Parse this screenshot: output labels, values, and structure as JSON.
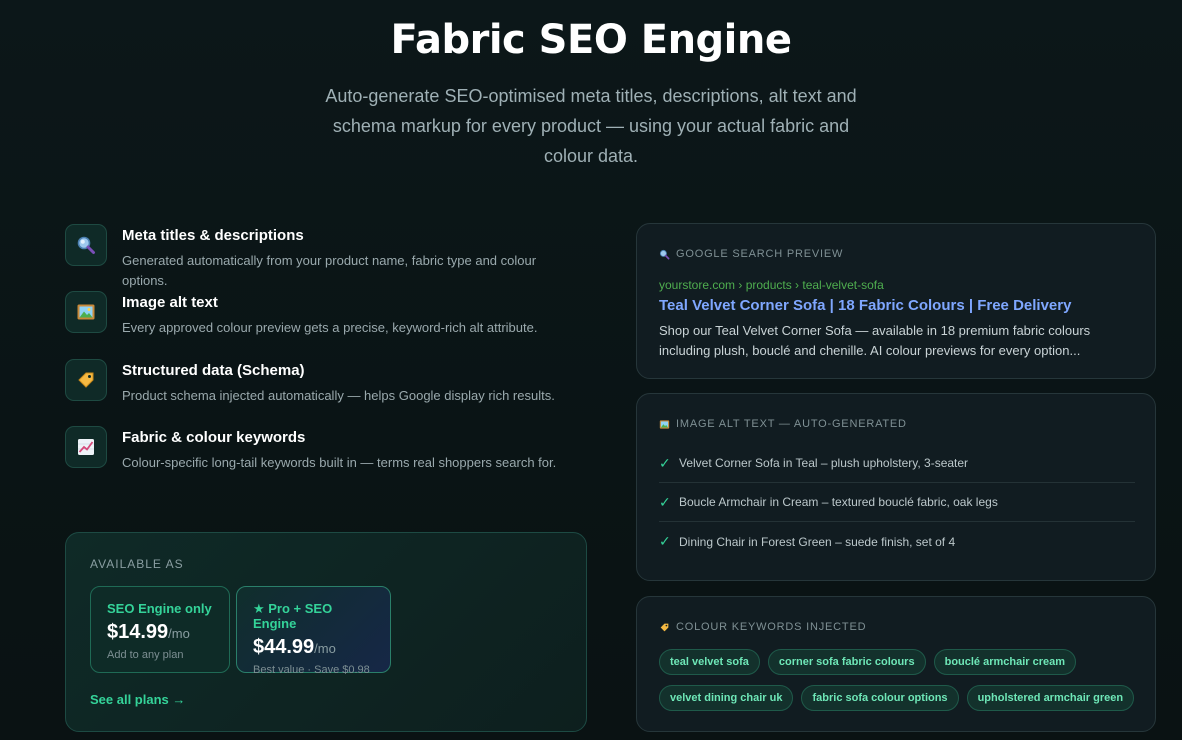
{
  "hero": {
    "title": "Fabric SEO Engine",
    "subtitle": "Auto-generate SEO-optimised meta titles, descriptions, alt text and schema markup for every product — using your actual fabric and colour data."
  },
  "features": [
    {
      "icon": "magnifier-icon",
      "title": "Meta titles & descriptions",
      "desc": "Generated automatically from your product name, fabric type and colour options."
    },
    {
      "icon": "picture-icon",
      "title": "Image alt text",
      "desc": "Every approved colour preview gets a precise, keyword-rich alt attribute."
    },
    {
      "icon": "tag-icon",
      "title": "Structured data (Schema)",
      "desc": "Product schema injected automatically — helps Google display rich results."
    },
    {
      "icon": "chart-icon",
      "title": "Fabric & colour keywords",
      "desc": "Colour-specific long-tail keywords built in — terms real shoppers search for."
    }
  ],
  "available": {
    "label": "AVAILABLE AS",
    "plans": [
      {
        "name": "SEO Engine only",
        "price": "$14.99",
        "period": "/mo",
        "sub": "Add to any plan"
      },
      {
        "name": "★ Pro + SEO Engine",
        "price": "$44.99",
        "period": "/mo",
        "sub": "Best value · Save $0.98"
      }
    ],
    "see_all": "See all plans →"
  },
  "google_preview": {
    "header": "GOOGLE SEARCH PREVIEW",
    "url": "yourstore.com › products › teal-velvet-sofa",
    "title": "Teal Velvet Corner Sofa | 18 Fabric Colours | Free Delivery",
    "desc": "Shop our Teal Velvet Corner Sofa — available in 18 premium fabric colours including plush, bouclé and chenille. AI colour previews for every option..."
  },
  "alt_text": {
    "header": "IMAGE ALT TEXT — AUTO-GENERATED",
    "items": [
      "Velvet Corner Sofa in Teal – plush upholstery, 3-seater",
      "Boucle Armchair in Cream – textured bouclé fabric, oak legs",
      "Dining Chair in Forest Green – suede finish, set of 4"
    ],
    "check": "✓"
  },
  "keywords": {
    "header": "COLOUR KEYWORDS INJECTED",
    "tags": [
      "teal velvet sofa",
      "corner sofa fabric colours",
      "bouclé armchair cream",
      "velvet dining chair uk",
      "fabric sofa colour options",
      "upholstered armchair green"
    ]
  }
}
